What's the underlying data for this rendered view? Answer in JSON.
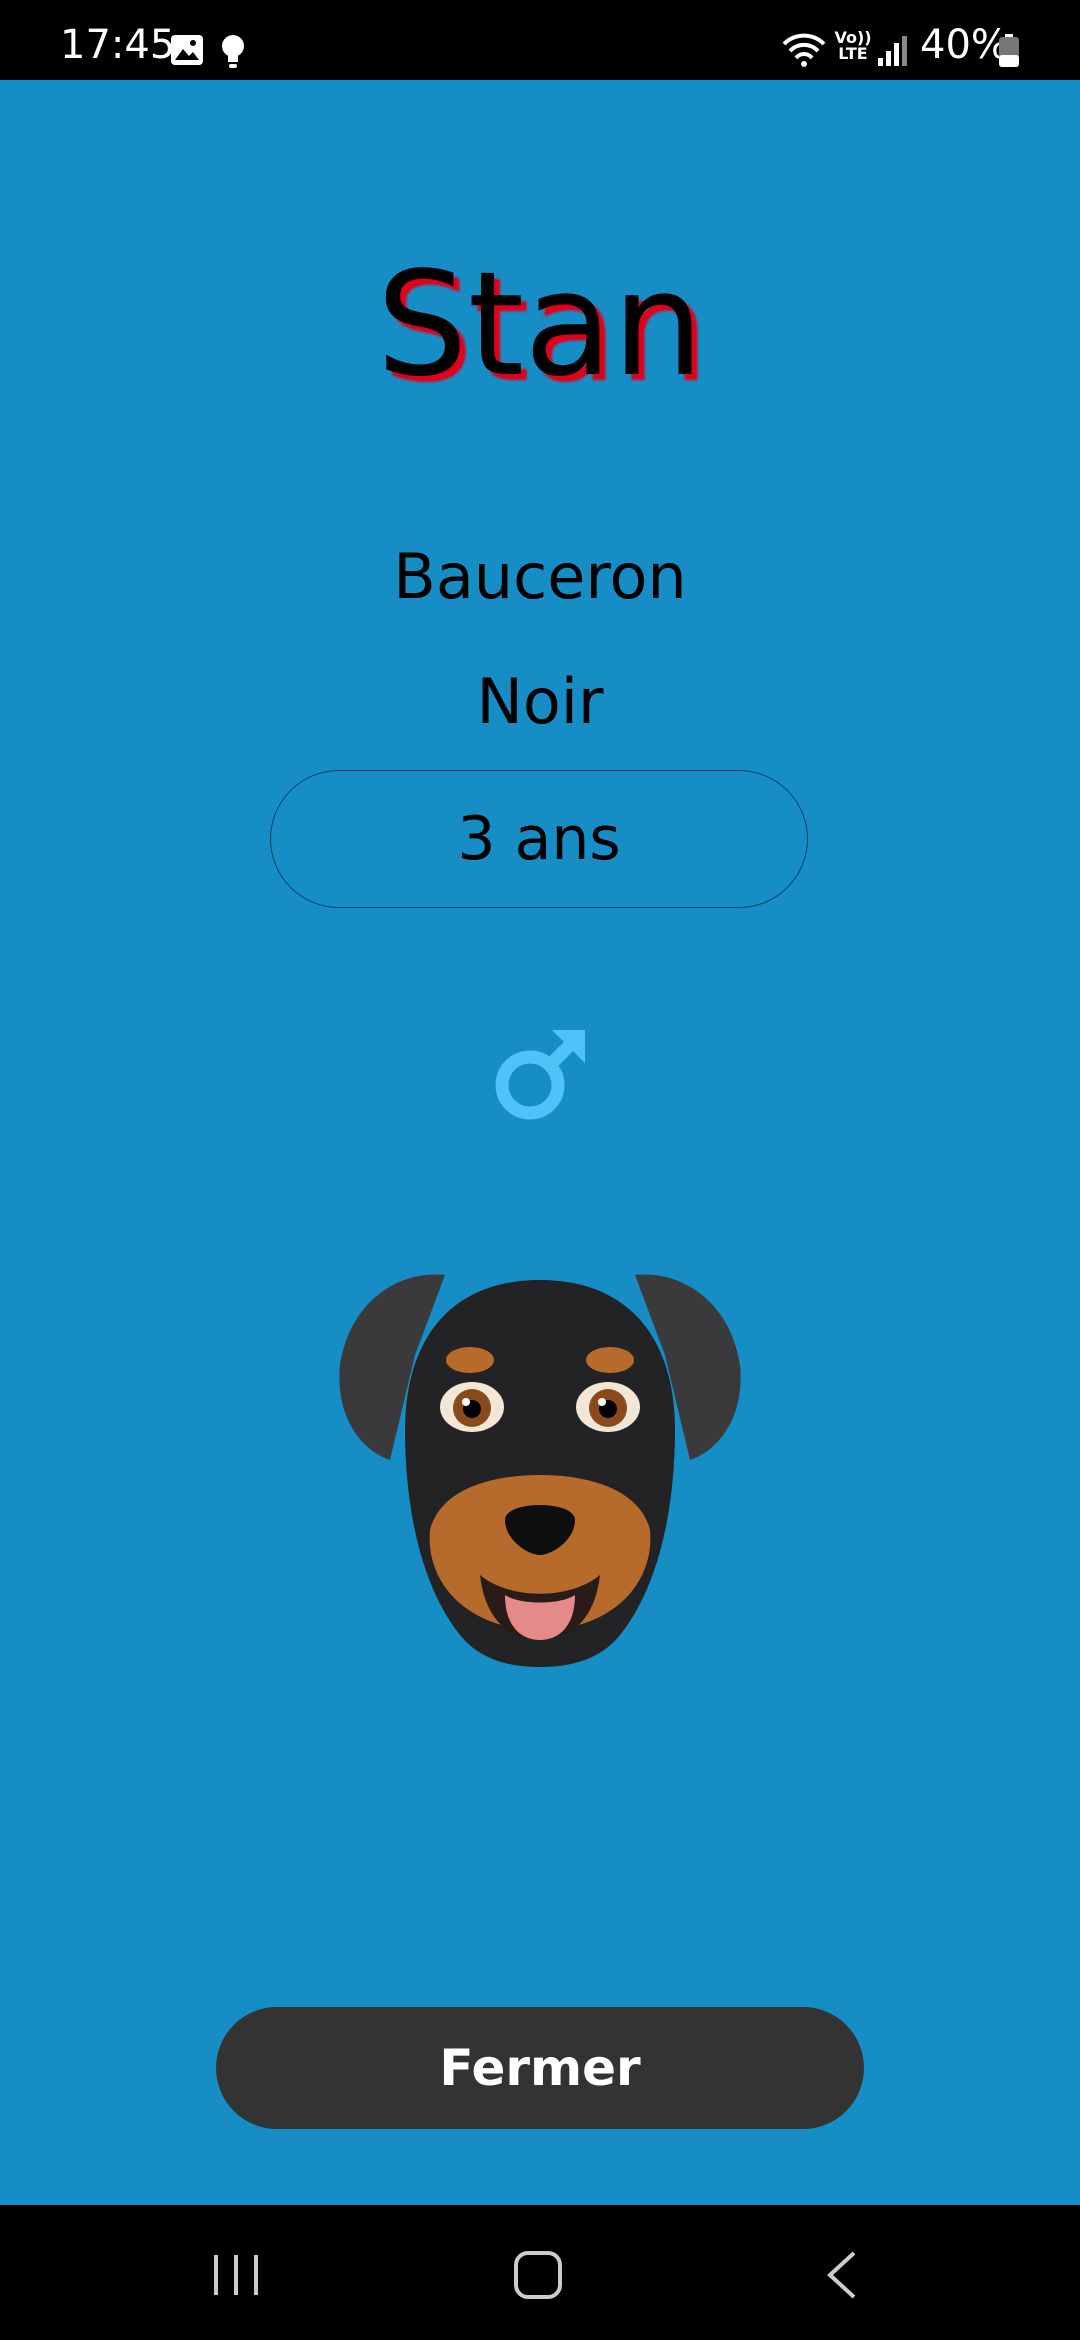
{
  "status_bar": {
    "time": "17:45",
    "volte": "Vo)) LTE",
    "battery_percent": "40%",
    "battery_level": 0.4
  },
  "profile": {
    "name": "Stan",
    "breed": "Bauceron",
    "color": "Noir",
    "age": "3 ans",
    "gender_symbol": "male-symbol-icon"
  },
  "actions": {
    "close_label": "Fermer"
  },
  "colors": {
    "background": "#178dc6",
    "name_shadow": "#e0001a",
    "gender_icon": "#4fc3f7",
    "button": "#333333"
  }
}
